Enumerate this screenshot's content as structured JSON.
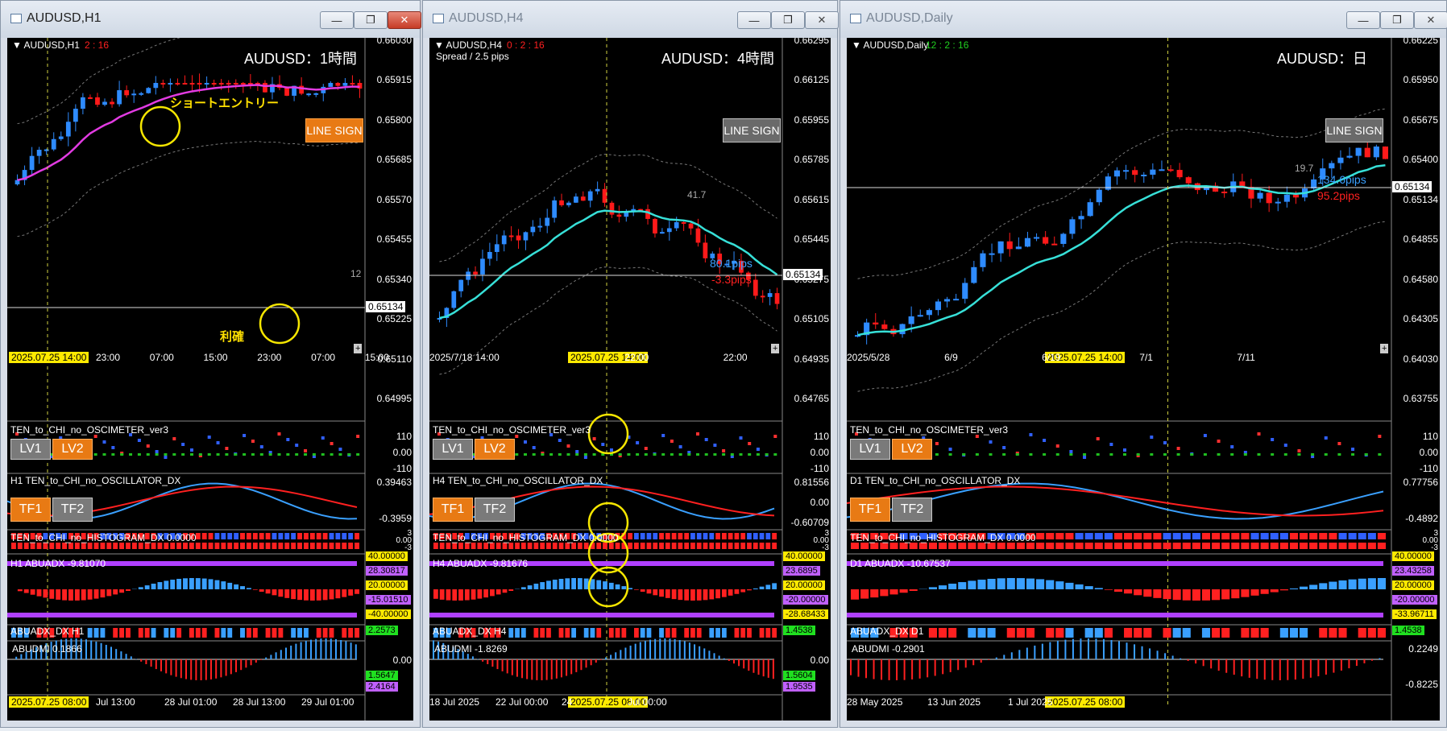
{
  "windows": [
    {
      "title": "AUDUSD,H1",
      "chart_label": "AUDUSD,H1",
      "timer": "2 : 16",
      "heading": "AUDUSD：1時間",
      "line_sign": "LINE SIGN",
      "annotation_entry": "ショートエントリー",
      "annotation_exit": "利確",
      "side_value": "12",
      "price_axis": [
        "0.66030",
        "0.65915",
        "0.65800",
        "0.65685",
        "0.65570",
        "0.65455",
        "0.65340",
        "0.65225",
        "0.65110",
        "0.64995"
      ],
      "current_price": "0.65134",
      "time_axis": [
        "23:00",
        "07:00",
        "15:00",
        "23:00",
        "07:00",
        "15:00"
      ],
      "time_badge": "2025.07.25 14:00",
      "oscimeter": "TEN_to_CHI_no_OSCIMETER_ver3",
      "osc_axis": [
        "110",
        "0.00",
        "-110"
      ],
      "oscillator": "H1  TEN_to_CHI_no_OSCILLATOR_DX",
      "oscillator_axis": [
        "0.39463",
        "-0.3959"
      ],
      "histogram": "TEN_to_CHI_no_HISTOGRAM_DX 0.0000",
      "hist_axis": [
        "3",
        "0.00",
        "-3"
      ],
      "abuadx": "H1  ABUADX  -9.81070",
      "abuadx_tags": [
        "40.00000",
        "28.30817",
        "20.00000",
        "-15.01510",
        "-40.00000"
      ],
      "abuadx_dx": "ABUADX_DX H1",
      "abuadx_dx_tag": "2.2573",
      "abudmi": "ABUDMI  0.1866",
      "abudmi_axis": [
        "0.00"
      ],
      "abudmi_tags": [
        "1.5647",
        "2.4164"
      ],
      "bottom_axis": [
        "Jul 13:00",
        "28 Jul 01:00",
        "28 Jul 13:00",
        "29 Jul 01:00"
      ],
      "bottom_badge": "2025.07.25 08:00",
      "lv1": "LV1",
      "lv2": "LV2",
      "tf1": "TF1",
      "tf2": "TF2"
    },
    {
      "title": "AUDUSD,H4",
      "chart_label": "AUDUSD,H4",
      "timer": "0 : 2 : 16",
      "spread": "Spread / 2.5 pips",
      "heading": "AUDUSD：4時間",
      "line_sign": "LINE SIGN",
      "side_value": "41.7",
      "pips_up": "80.1pips",
      "pips_down": "-3.3pips",
      "price_axis": [
        "0.66295",
        "0.66125",
        "0.65955",
        "0.65785",
        "0.65615",
        "0.65445",
        "0.65275",
        "0.65105",
        "0.64935",
        "0.64765"
      ],
      "current_price": "0.65134",
      "time_axis": [
        "2025/7/18 14:00",
        "22:00",
        "22:00"
      ],
      "time_badge": "2025.07.25 14:00",
      "oscimeter": "TEN_to_CHI_no_OSCIMETER_ver3",
      "osc_axis": [
        "110",
        "0.00",
        "-110"
      ],
      "oscillator": "H4  TEN_to_CHI_no_OSCILLATOR_DX",
      "oscillator_axis": [
        "0.81556",
        "0.00",
        "-0.60709"
      ],
      "histogram": "TEN_to_CHI_no_HISTOGRAM_DX 0.0000",
      "hist_axis": [
        "3",
        "0.00",
        "-3"
      ],
      "abuadx": "H4  ABUADX  -9.81676",
      "abuadx_tags": [
        "40.00000",
        "23.6895",
        "20.00000",
        "-20.00000",
        "-28.68433"
      ],
      "abuadx_dx": "ABUADX_DX H4",
      "abuadx_dx_tag": "1.4538",
      "abudmi": "ABUDMI  -1.8269",
      "abudmi_axis": [
        "0.00"
      ],
      "abudmi_tags": [
        "1.5604",
        "1.9535"
      ],
      "bottom_axis": [
        "18 Jul 2025",
        "22 Jul 00:00",
        "24",
        "Jul 00:00"
      ],
      "bottom_badge": "2025.07.25 08:00",
      "lv1": "LV1",
      "lv2": "LV2",
      "tf1": "TF1",
      "tf2": "TF2"
    },
    {
      "title": "AUDUSD,Daily",
      "chart_label": "AUDUSD,Daily",
      "timer": "12 : 2 : 16",
      "heading": "AUDUSD：日",
      "line_sign": "LINE SIGN",
      "side_value": "19.7",
      "pips_up": "134.6pips",
      "pips_down": "95.2pips",
      "price_axis": [
        "0.66225",
        "0.65950",
        "0.65675",
        "0.65400",
        "0.65134",
        "0.64855",
        "0.64580",
        "0.64305",
        "0.64030",
        "0.63755"
      ],
      "current_price": "0.65134",
      "time_axis": [
        "2025/5/28",
        "6/9",
        "6/19",
        "7/1",
        "7/11"
      ],
      "time_badge": "2025.07.25 14:00",
      "oscimeter": "TEN_to_CHI_no_OSCIMETER_ver3",
      "osc_axis": [
        "110",
        "0.00",
        "-110"
      ],
      "oscillator": "D1  TEN_to_CHI_no_OSCILLATOR_DX",
      "oscillator_axis": [
        "0.77756",
        "-0.4892"
      ],
      "histogram": "TEN_to_CHI_no_HISTOGRAM_DX 0.0000",
      "hist_axis": [
        "3",
        "0.00",
        "-3"
      ],
      "abuadx": "D1  ABUADX  -10.67537",
      "abuadx_tags": [
        "40.00000",
        "23.43258",
        "20.00000",
        "-20.00000",
        "-33.96711"
      ],
      "abuadx_dx": "ABUADX_DX D1",
      "abuadx_dx_tag": "1.4538",
      "abudmi": "ABUDMI  -0.2901",
      "abudmi_axis": [
        "0.2249",
        "-0.8225"
      ],
      "abudmi_tags": [],
      "bottom_axis": [
        "28 May 2025",
        "13 Jun 2025",
        "1 Jul 2025"
      ],
      "bottom_badge": "2025.07.25 08:00",
      "lv1": "LV1",
      "lv2": "LV2",
      "tf1": "TF1",
      "tf2": "TF2"
    }
  ],
  "colors": {
    "bull": "#2e8bff",
    "bear": "#ff1a1a",
    "ma_h1": "#e23be2",
    "ma_teal": "#37e0d8",
    "badge": "#ffea00",
    "purple": "#b040ff"
  }
}
